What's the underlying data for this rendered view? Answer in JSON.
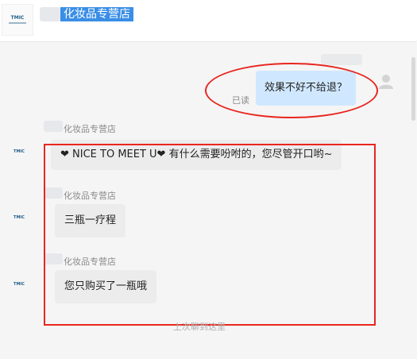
{
  "header": {
    "shop_title": "化妆品专营店",
    "logo_text": "TMIC"
  },
  "messages": [
    {
      "side": "right",
      "text": "效果不好不给退？",
      "status": "已读"
    },
    {
      "side": "left",
      "sender": "化妆品专营店",
      "text": "❤ NICE TO MEET U❤ 有什么需要吩咐的，您尽管开口哟~"
    },
    {
      "side": "left",
      "sender": "化妆品专营店",
      "text": "三瓶一疗程"
    },
    {
      "side": "left",
      "sender": "化妆品专营店",
      "text": "您只购买了一瓶哦"
    }
  ],
  "history_divider": "上次聊到这里",
  "colors": {
    "accent": "#3a8ee6",
    "own_bubble": "#d0e8ff",
    "other_bubble": "#ececec",
    "annotation_red": "#e8261e"
  }
}
